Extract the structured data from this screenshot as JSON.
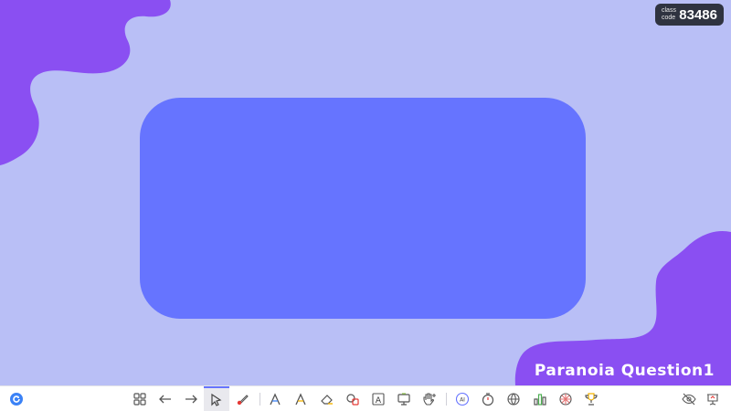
{
  "slide": {
    "title": "Paranoia Question1",
    "class_code_label": "class code",
    "class_code": "83486"
  },
  "colors": {
    "background": "#b9bff6",
    "blob": "#8a4ff2",
    "card": "#6674ff",
    "toolbar_accent": "#6674ff"
  },
  "toolbar": {
    "left": [
      {
        "icon": "refresh-logo-icon"
      }
    ],
    "center": [
      {
        "icon": "grid-icon"
      },
      {
        "icon": "arrow-left-icon"
      },
      {
        "icon": "arrow-right-icon"
      },
      {
        "icon": "cursor-icon",
        "active": true
      },
      {
        "icon": "laser-pointer-icon"
      },
      {
        "icon": "pen-icon"
      },
      {
        "icon": "highlighter-icon"
      },
      {
        "icon": "eraser-icon"
      },
      {
        "icon": "shapes-icon"
      },
      {
        "icon": "text-box-icon",
        "text": "A"
      },
      {
        "icon": "whiteboard-icon"
      },
      {
        "icon": "hand-plus-icon"
      },
      {
        "icon": "ai-icon",
        "text": "AI"
      },
      {
        "icon": "timer-icon"
      },
      {
        "icon": "browser-icon"
      },
      {
        "icon": "bar-chart-icon"
      },
      {
        "icon": "wheel-icon"
      },
      {
        "icon": "trophy-icon"
      }
    ],
    "right": [
      {
        "icon": "eye-icon"
      },
      {
        "icon": "presentation-icon"
      }
    ]
  }
}
